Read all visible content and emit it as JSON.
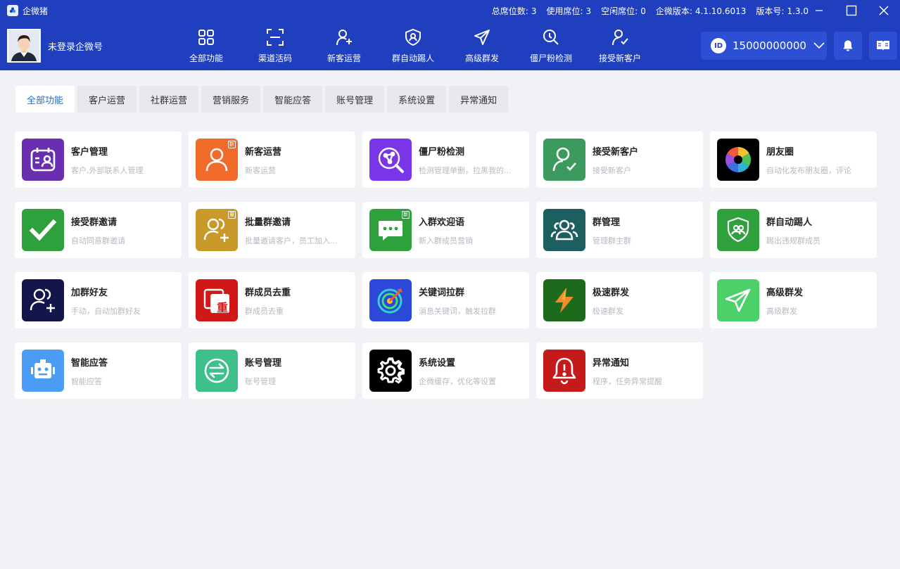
{
  "titlebar": {
    "app_name": "企微猪",
    "stats": [
      {
        "label": "总席位数:",
        "value": "3"
      },
      {
        "label": "使用席位:",
        "value": "3"
      },
      {
        "label": "空闲席位:",
        "value": "0"
      },
      {
        "label": "企微版本:",
        "value": "4.1.10.6013"
      },
      {
        "label": "版本号:",
        "value": "1.3.0"
      }
    ]
  },
  "header": {
    "login_label": "未登录企微号",
    "nav": [
      {
        "label": "全部功能",
        "icon": "grid-icon"
      },
      {
        "label": "渠道活码",
        "icon": "scan-icon"
      },
      {
        "label": "新客运营",
        "icon": "user-add-icon"
      },
      {
        "label": "群自动踢人",
        "icon": "shield-icon"
      },
      {
        "label": "高级群发",
        "icon": "send-icon"
      },
      {
        "label": "僵尸粉检测",
        "icon": "search-icon"
      },
      {
        "label": "接受新客户",
        "icon": "user-check-icon"
      }
    ],
    "account": {
      "id_badge": "ID",
      "number": "15000000000"
    }
  },
  "tabs": [
    "全部功能",
    "客户运营",
    "社群运营",
    "营销服务",
    "智能应答",
    "账号管理",
    "系统设置",
    "异常通知"
  ],
  "colors": {
    "primary": "#1f3fbf",
    "active_tab": "#1f6fd8",
    "background": "#f0f2f5"
  },
  "cards": [
    {
      "title": "客户管理",
      "desc": "客户,外部联系人管理",
      "icon": "contact-calendar-icon",
      "color": "#6a2fb0"
    },
    {
      "title": "新客运营",
      "desc": "新客运营",
      "icon": "user-icon",
      "color": "#f06a2a",
      "badge": "新"
    },
    {
      "title": "僵尸粉检测",
      "desc": "检测管理单删，拉黑我的...",
      "icon": "search-icon",
      "color": "#7b35e8"
    },
    {
      "title": "接受新客户",
      "desc": "接受新客户",
      "icon": "user-check-icon",
      "color": "#3c9a5f"
    },
    {
      "title": "朋友圈",
      "desc": "自动化发布朋友圈，评论",
      "icon": "aperture-icon",
      "color": "#000000"
    },
    {
      "title": "接受群邀请",
      "desc": "自动同意群邀请",
      "icon": "check-icon",
      "color": "#2ea03c"
    },
    {
      "title": "批量群邀请",
      "desc": "批量邀请客户，员工加入...",
      "icon": "users-add-icon",
      "color": "#c99a2a",
      "badge": "量"
    },
    {
      "title": "入群欢迎语",
      "desc": "新入群成员营销",
      "icon": "chat-icon",
      "color": "#2ea03c",
      "badge": "新"
    },
    {
      "title": "群管理",
      "desc": "管理群主群",
      "icon": "group-icon",
      "color": "#1d5e5e"
    },
    {
      "title": "群自动踢人",
      "desc": "踢出违规群成员",
      "icon": "shield-icon",
      "color": "#2ea03c"
    },
    {
      "title": "加群好友",
      "desc": "手动，自动加群好友",
      "icon": "users-add-icon",
      "color": "#14154a"
    },
    {
      "title": "群成员去重",
      "desc": "群成员去重",
      "icon": "dedupe-icon",
      "color": "#d01818",
      "glyph": "重"
    },
    {
      "title": "关键词拉群",
      "desc": "消息关键词，触发拉群",
      "icon": "target-icon",
      "color": "#2c48d8"
    },
    {
      "title": "极速群发",
      "desc": "极速群发",
      "icon": "lightning-icon",
      "color": "#1d6a1d"
    },
    {
      "title": "高级群发",
      "desc": "高级群发",
      "icon": "send-icon",
      "color": "#4cd06a"
    },
    {
      "title": "智能应答",
      "desc": "智能应答",
      "icon": "robot-icon",
      "color": "#4a9cf4"
    },
    {
      "title": "账号管理",
      "desc": "账号管理",
      "icon": "switch-icon",
      "color": "#3ec08a"
    },
    {
      "title": "系统设置",
      "desc": "企微缓存，优化等设置",
      "icon": "gear-icon",
      "color": "#000000"
    },
    {
      "title": "异常通知",
      "desc": "程序，任务异常提醒",
      "icon": "bell-icon",
      "color": "#c41a1a"
    }
  ]
}
